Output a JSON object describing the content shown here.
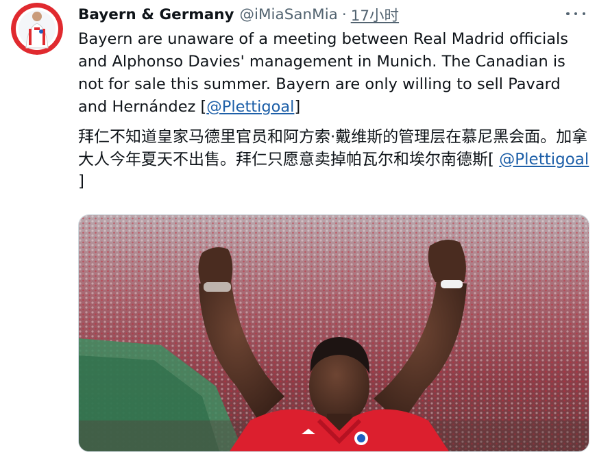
{
  "tweet": {
    "display_name": "Bayern & Germany",
    "handle": "@iMiaSanMia",
    "separator": "·",
    "time": "17小时",
    "more_icon": "more-horizontal-icon",
    "body_en_text": "Bayern are unaware of a meeting between Real Madrid officials and Alphonso Davies' management in Munich. The Canadian is not for sale this summer. Bayern are only willing to sell Pavard and Hernández [",
    "body_en_link": "@Plettigoal",
    "body_en_close": "]",
    "body_zh_text": "拜仁不知道皇家马德里官员和阿方索·戴维斯的管理层在慕尼黑会面。加拿大人今年夏天不出售。拜仁只愿意卖掉帕瓦尔和埃尔南德斯[ ",
    "body_zh_link": "@Plettigoal",
    "body_zh_close": " ]",
    "colors": {
      "text": "#0f1419",
      "secondary": "#536471",
      "link": "#1d5fa8",
      "jersey_red": "#dc1f2e"
    }
  }
}
